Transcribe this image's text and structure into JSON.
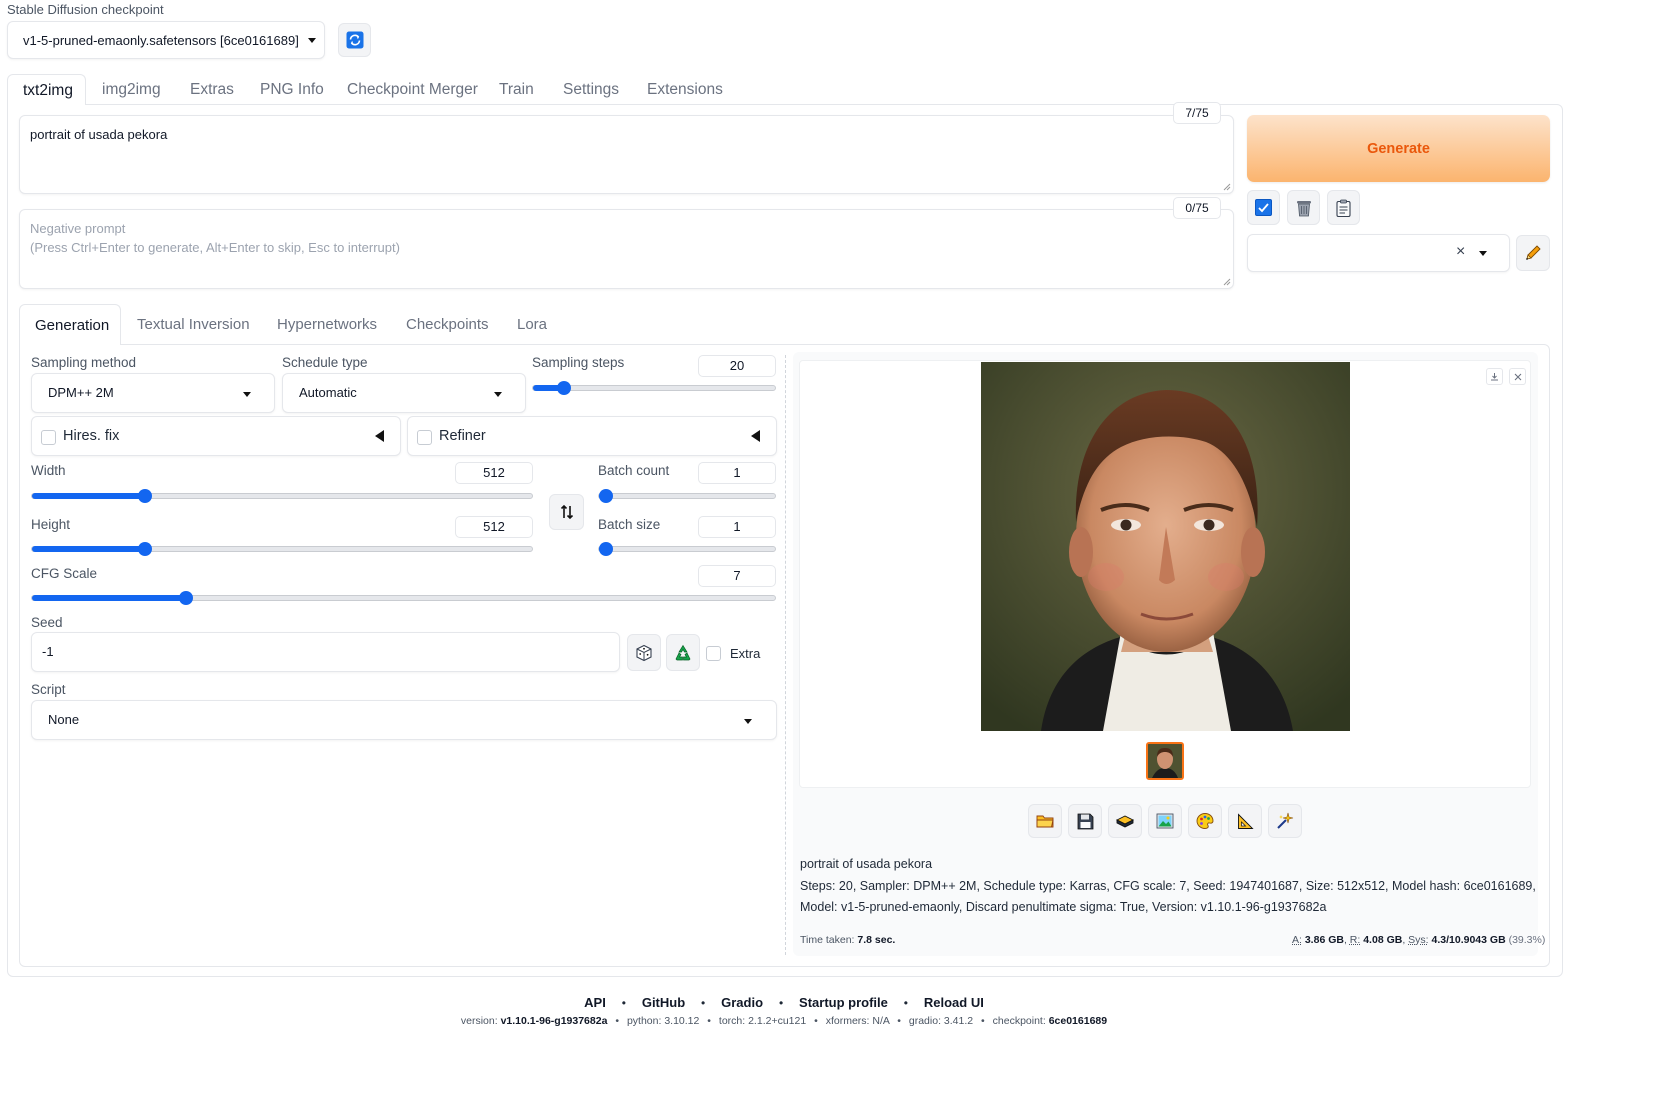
{
  "checkpoint": {
    "label": "Stable Diffusion checkpoint",
    "value": "v1-5-pruned-emaonly.safetensors [6ce0161689]",
    "refresh_icon": "refresh-icon"
  },
  "main_tabs": [
    "txt2img",
    "img2img",
    "Extras",
    "PNG Info",
    "Checkpoint Merger",
    "Train",
    "Settings",
    "Extensions"
  ],
  "prompt": {
    "value": "portrait of usada pekora",
    "token_count": "7/75"
  },
  "negative_prompt": {
    "placeholder_line1": "Negative prompt",
    "placeholder_line2": "(Press Ctrl+Enter to generate, Alt+Enter to skip, Esc to interrupt)",
    "token_count": "0/75"
  },
  "actions": {
    "generate_label": "Generate",
    "clear_symbol": "×"
  },
  "sub_tabs": [
    "Generation",
    "Textual Inversion",
    "Hypernetworks",
    "Checkpoints",
    "Lora"
  ],
  "generation": {
    "sampling_method": {
      "label": "Sampling method",
      "value": "DPM++ 2M"
    },
    "schedule_type": {
      "label": "Schedule type",
      "value": "Automatic"
    },
    "sampling_steps": {
      "label": "Sampling steps",
      "value": "20",
      "min": 1,
      "max": 150,
      "current": 20
    },
    "hires_fix": {
      "label": "Hires. fix",
      "checked": false
    },
    "refiner": {
      "label": "Refiner",
      "checked": false
    },
    "width": {
      "label": "Width",
      "value": "512",
      "min": 64,
      "max": 2048,
      "current": 512
    },
    "height": {
      "label": "Height",
      "value": "512",
      "min": 64,
      "max": 2048,
      "current": 512
    },
    "swap_icon": "swap-icon",
    "batch_count": {
      "label": "Batch count",
      "value": "1",
      "min": 1,
      "max": 100,
      "current": 1
    },
    "batch_size": {
      "label": "Batch size",
      "value": "1",
      "min": 1,
      "max": 8,
      "current": 1
    },
    "cfg_scale": {
      "label": "CFG Scale",
      "value": "7",
      "min": 1,
      "max": 30,
      "current": 7
    },
    "seed": {
      "label": "Seed",
      "value": "-1"
    },
    "extra_label": "Extra",
    "script": {
      "label": "Script",
      "value": "None"
    }
  },
  "output": {
    "prompt_text": "portrait of usada pekora",
    "params_line1": "Steps: 20, Sampler: DPM++ 2M, Schedule type: Karras, CFG scale: 7, Seed: 1947401687, Size: 512x512, Model hash: 6ce0161689,",
    "params_line2": "Model: v1-5-pruned-emaonly, Discard penultimate sigma: True, Version: v1.10.1-96-g1937682a",
    "time_label": "Time taken:",
    "time_value": "7.8 sec.",
    "mem_a_label": "A:",
    "mem_a": "3.86 GB",
    "mem_r_label": "R:",
    "mem_r": "4.08 GB",
    "mem_sys_label": "Sys:",
    "mem_sys": "4.3/10.9043 GB",
    "mem_pct": "(39.3%)",
    "toolbar_icons": [
      "folder-icon",
      "save-icon",
      "zip-icon",
      "send-to-img2img-icon",
      "send-to-inpaint-icon",
      "send-to-extras-icon",
      "sparkle-icon"
    ]
  },
  "footer": {
    "links": [
      "API",
      "GitHub",
      "Gradio",
      "Startup profile",
      "Reload UI"
    ],
    "separator": "•",
    "version_label": "version:",
    "version": "v1.10.1-96-g1937682a",
    "python_label": "python:",
    "python": "3.10.12",
    "torch_label": "torch:",
    "torch": "2.1.2+cu121",
    "xformers_label": "xformers:",
    "xformers": "N/A",
    "gradio_label": "gradio:",
    "gradio": "3.41.2",
    "checkpoint_label": "checkpoint:",
    "checkpoint": "6ce0161689"
  },
  "colors": {
    "accent": "#1366f0",
    "generate_start": "#fde0c5",
    "generate_end": "#fbb36b",
    "generate_text": "#ea580c"
  }
}
